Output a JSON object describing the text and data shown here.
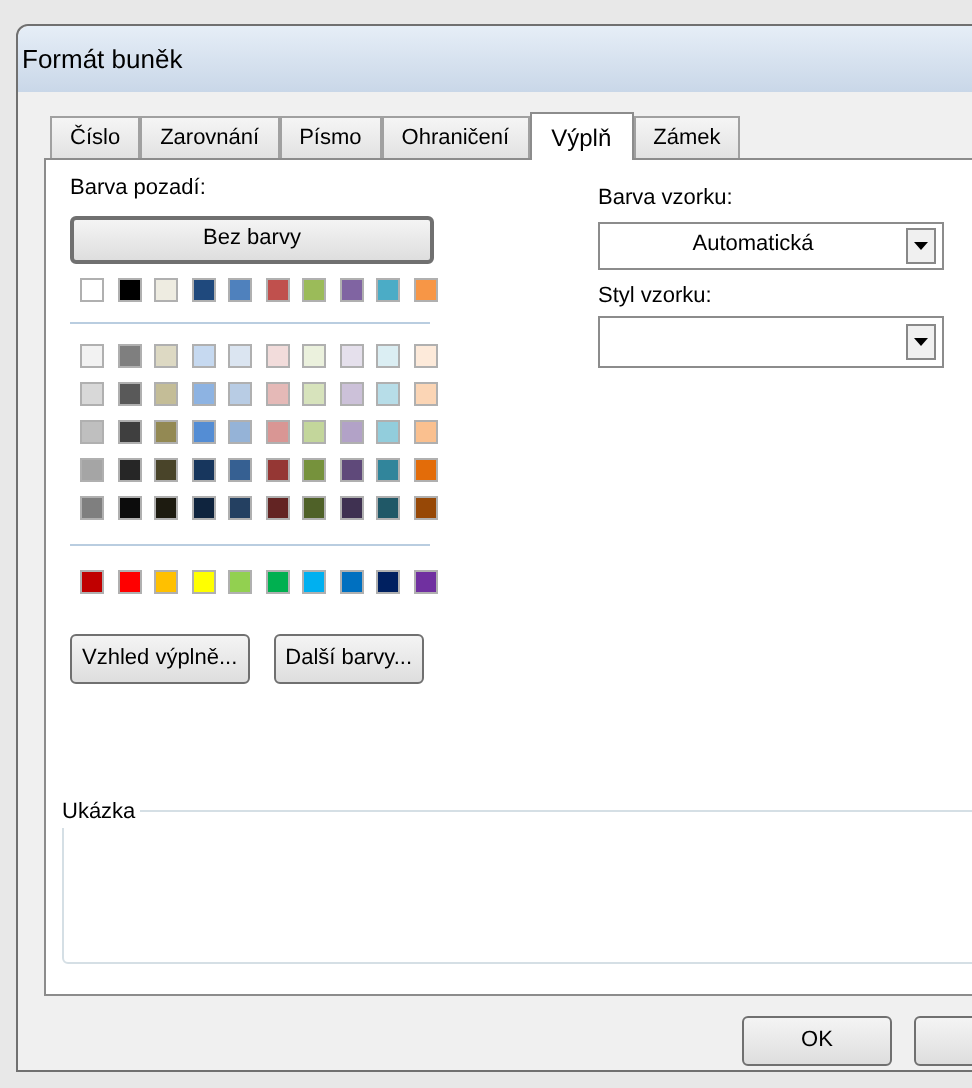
{
  "window": {
    "title": "Formát buněk"
  },
  "tabs": [
    {
      "label": "Číslo",
      "selected": false
    },
    {
      "label": "Zarovnání",
      "selected": false
    },
    {
      "label": "Písmo",
      "selected": false
    },
    {
      "label": "Ohraničení",
      "selected": false
    },
    {
      "label": "Výplň",
      "selected": true
    },
    {
      "label": "Zámek",
      "selected": false
    }
  ],
  "background_color": {
    "label": "Barva pozadí:",
    "no_color_button": "Bez barvy",
    "theme_colors": [
      {
        "color": "#ffffff"
      },
      {
        "color": "#000000"
      },
      {
        "color": "#eeece1"
      },
      {
        "color": "#1f497d"
      },
      {
        "color": "#4f81bd"
      },
      {
        "color": "#c0504d"
      },
      {
        "color": "#9bbb59"
      },
      {
        "color": "#8064a2"
      },
      {
        "color": "#4bacc6"
      },
      {
        "color": "#f79646"
      }
    ],
    "shade_rows": [
      [
        {
          "color": "#f2f2f2"
        },
        {
          "color": "#7f7f7f"
        },
        {
          "color": "#ddd9c3"
        },
        {
          "color": "#c6d9f0"
        },
        {
          "color": "#dbe5f1"
        },
        {
          "color": "#f2dcdb"
        },
        {
          "color": "#ebf1dd"
        },
        {
          "color": "#e5e0ec"
        },
        {
          "color": "#dbeef3"
        },
        {
          "color": "#fdeada"
        }
      ],
      [
        {
          "color": "#d8d8d8"
        },
        {
          "color": "#595959"
        },
        {
          "color": "#c4bd97"
        },
        {
          "color": "#8db3e2"
        },
        {
          "color": "#b8cce4"
        },
        {
          "color": "#e5b9b7"
        },
        {
          "color": "#d7e3bc"
        },
        {
          "color": "#ccc1d9"
        },
        {
          "color": "#b7dde8"
        },
        {
          "color": "#fbd5b5"
        }
      ],
      [
        {
          "color": "#bfbfbf"
        },
        {
          "color": "#3f3f3f"
        },
        {
          "color": "#938953"
        },
        {
          "color": "#548dd4"
        },
        {
          "color": "#95b3d7"
        },
        {
          "color": "#d99694"
        },
        {
          "color": "#c3d69b"
        },
        {
          "color": "#b2a2c7"
        },
        {
          "color": "#92cddc"
        },
        {
          "color": "#fac08f"
        }
      ],
      [
        {
          "color": "#a5a5a5"
        },
        {
          "color": "#262626"
        },
        {
          "color": "#494429"
        },
        {
          "color": "#17365d"
        },
        {
          "color": "#366092"
        },
        {
          "color": "#953734"
        },
        {
          "color": "#76923c"
        },
        {
          "color": "#5f497a"
        },
        {
          "color": "#31859b"
        },
        {
          "color": "#e36c09"
        }
      ],
      [
        {
          "color": "#7f7f7f"
        },
        {
          "color": "#0c0c0c"
        },
        {
          "color": "#1d1b10"
        },
        {
          "color": "#0f243e"
        },
        {
          "color": "#244061"
        },
        {
          "color": "#632423"
        },
        {
          "color": "#4f6128"
        },
        {
          "color": "#3f3151"
        },
        {
          "color": "#205867"
        },
        {
          "color": "#974806"
        }
      ]
    ],
    "standard_colors": [
      {
        "color": "#c00000"
      },
      {
        "color": "#ff0000"
      },
      {
        "color": "#ffc000"
      },
      {
        "color": "#ffff00"
      },
      {
        "color": "#92d050"
      },
      {
        "color": "#00b050"
      },
      {
        "color": "#00b0f0"
      },
      {
        "color": "#0070c0"
      },
      {
        "color": "#002060"
      },
      {
        "color": "#7030a0"
      }
    ],
    "buttons": [
      "Vzhled výplně...",
      "Další barvy..."
    ]
  },
  "pattern_color": {
    "label": "Barva vzorku:",
    "value": "Automatická"
  },
  "pattern_style": {
    "label": "Styl vzorku:"
  },
  "sample": {
    "label": "Ukázka"
  },
  "footer_buttons": [
    "OK"
  ]
}
